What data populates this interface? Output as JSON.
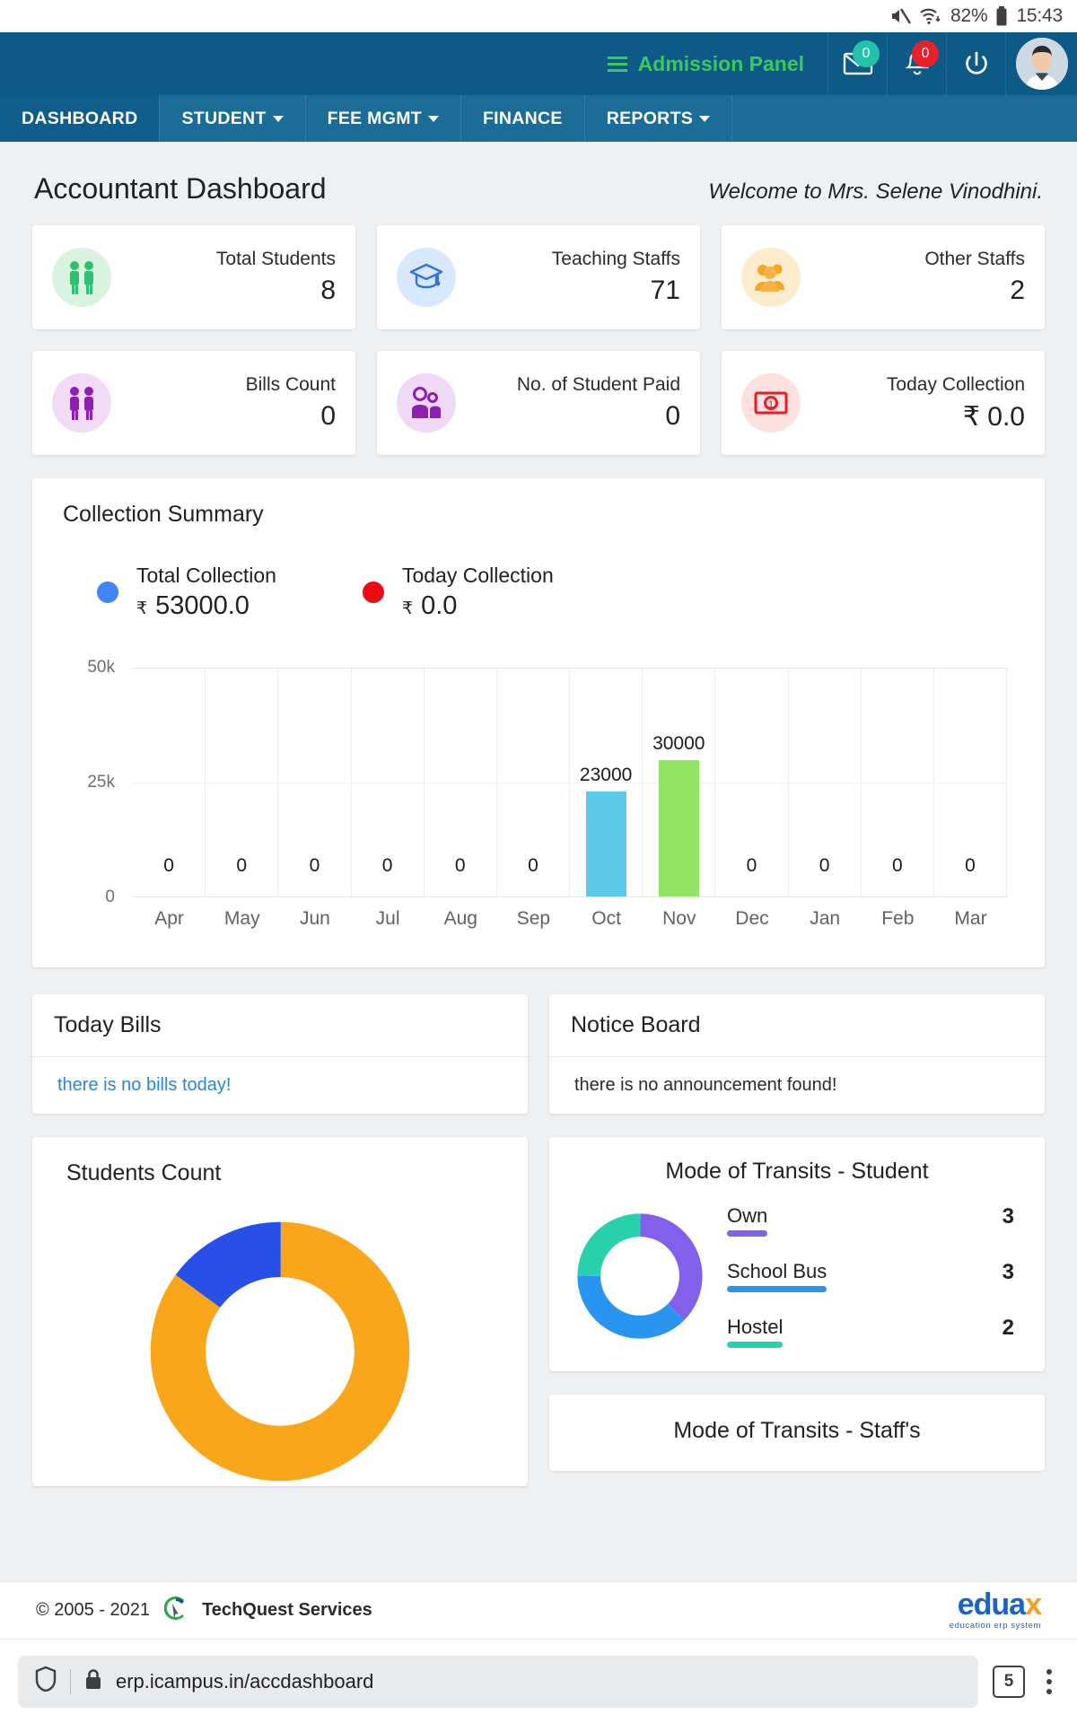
{
  "statusbar": {
    "battery": "82%",
    "time": "15:43",
    "mute_icon": "mute-icon",
    "wifi_icon": "wifi-icon",
    "battery_icon": "battery-icon"
  },
  "topbar": {
    "admission_panel": "Admission Panel",
    "mail_badge": "0",
    "bell_badge": "0",
    "power_icon": "power-icon",
    "avatar": "user-avatar"
  },
  "menu": [
    {
      "label": "DASHBOARD",
      "caret": false,
      "active": true
    },
    {
      "label": "STUDENT",
      "caret": true,
      "active": false
    },
    {
      "label": "FEE MGMT",
      "caret": true,
      "active": false
    },
    {
      "label": "FINANCE",
      "caret": false,
      "active": false
    },
    {
      "label": "REPORTS",
      "caret": true,
      "active": false
    }
  ],
  "page": {
    "title": "Accountant Dashboard",
    "welcome": "Welcome to Mrs. Selene Vinodhini."
  },
  "stats": [
    {
      "label": "Total Students",
      "value": "8",
      "icon": "students-couple-icon",
      "blob": "#d8f3e0",
      "color": "#2fbf71"
    },
    {
      "label": "Teaching Staffs",
      "value": "71",
      "icon": "graduation-cap-icon",
      "blob": "#d9e9fd",
      "color": "#2f72e8"
    },
    {
      "label": "Other Staffs",
      "value": "2",
      "icon": "people-group-icon",
      "blob": "#fdeccd",
      "color": "#f5a623"
    },
    {
      "label": "Bills Count",
      "value": "0",
      "icon": "bill-people-icon",
      "blob": "#f2dcf5",
      "color": "#8c1fb0"
    },
    {
      "label": "No. of Student Paid",
      "value": "0",
      "icon": "two-persons-icon",
      "blob": "#f0d9f7",
      "color": "#8c1fb0"
    },
    {
      "label": "Today Collection",
      "value": "₹ 0.0",
      "icon": "banknote-icon",
      "blob": "#fde0e0",
      "color": "#ee1b24"
    }
  ],
  "collection": {
    "title": "Collection Summary",
    "legend": [
      {
        "name": "Total Collection",
        "rupee": "₹",
        "value": "53000.0",
        "color": "#4285f4"
      },
      {
        "name": "Today Collection",
        "rupee": "₹",
        "value": "0.0",
        "color": "#ea0b14"
      }
    ]
  },
  "chart_data": {
    "type": "bar",
    "title": "Collection Summary",
    "xlabel": "",
    "ylabel": "",
    "ylim": [
      0,
      50000
    ],
    "yticks": [
      "0",
      "25k",
      "50k"
    ],
    "ytick_values": [
      0,
      25000,
      50000
    ],
    "grid": true,
    "legend_position": "top-left",
    "categories": [
      "Apr",
      "May",
      "Jun",
      "Jul",
      "Aug",
      "Sep",
      "Oct",
      "Nov",
      "Dec",
      "Jan",
      "Feb",
      "Mar"
    ],
    "values": [
      0,
      0,
      0,
      0,
      0,
      0,
      23000,
      30000,
      0,
      0,
      0,
      0
    ],
    "bar_labels": [
      "0",
      "0",
      "0",
      "0",
      "0",
      "0",
      "23000",
      "30000",
      "0",
      "0",
      "0",
      "0"
    ],
    "bar_colors": [
      "#6dd5ed",
      "#6dd5ed",
      "#6dd5ed",
      "#6dd5ed",
      "#6dd5ed",
      "#6dd5ed",
      "#5cc9e8",
      "#94e565",
      "#6dd5ed",
      "#6dd5ed",
      "#6dd5ed",
      "#6dd5ed"
    ]
  },
  "today_bills": {
    "title": "Today Bills",
    "message": "there is no bills today!"
  },
  "notice_board": {
    "title": "Notice Board",
    "message": "there is no announcement found!"
  },
  "students_count": {
    "title": "Students Count",
    "chart": {
      "type": "pie",
      "title": "Students Count",
      "labels": [
        "Orange segment",
        "Blue segment"
      ],
      "values": [
        85,
        15
      ],
      "colors": [
        "#f9a61a",
        "#2850e8"
      ]
    }
  },
  "transits_student": {
    "title": "Mode of Transits - Student",
    "chart": {
      "type": "pie",
      "title": "Mode of Transits - Student",
      "labels": [
        "Own",
        "School Bus",
        "Hostel"
      ],
      "values": [
        3,
        3,
        2
      ],
      "colors": [
        "#8161ec",
        "#2a95f0",
        "#27d1ac"
      ]
    },
    "items": [
      {
        "label": "Own",
        "value": "3",
        "color": "#8161ec"
      },
      {
        "label": "School Bus",
        "value": "3",
        "color": "#2a95f0"
      },
      {
        "label": "Hostel",
        "value": "2",
        "color": "#27d1ac"
      }
    ]
  },
  "transits_staff": {
    "title": "Mode of Transits - Staff's"
  },
  "footer": {
    "copyright": "© 2005 - 2021",
    "brand": "TechQuest Services",
    "logo_word": "edu",
    "logo_a": "a",
    "logo_x": "x",
    "logo_tagline": "education erp system"
  },
  "browser": {
    "url": "erp.icampus.in/accdashboard",
    "tab_count": "5",
    "shield_icon": "shield-icon",
    "lock_icon": "lock-icon",
    "menu_icon": "kebab-menu-icon"
  }
}
